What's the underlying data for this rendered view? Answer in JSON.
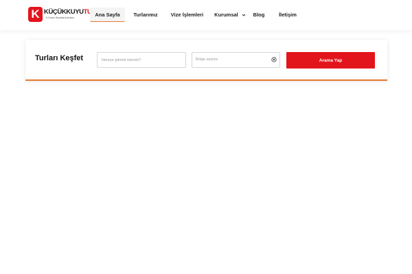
{
  "brand": {
    "logo_mark": "K",
    "name_main": "KÜÇÜKKUYU",
    "name_accent": "TUR",
    "tagline": "A Grubu Seyahat Acentası",
    "primary_color": "#e3151c",
    "accent_color": "#e8772e"
  },
  "nav": {
    "items": [
      {
        "label": "Ana Sayfa",
        "active": true
      },
      {
        "label": "Turlarımız"
      },
      {
        "label": "Vize İşlemleri"
      },
      {
        "label": "Kurumsal",
        "has_dropdown": true
      },
      {
        "label": "Blog"
      },
      {
        "label": "İletişim"
      }
    ]
  },
  "search": {
    "title": "Turları Keşfet",
    "destination_placeholder": "Nereye gitmek istersin?",
    "region_placeholder": "Bölge seçiniz",
    "button_label": "Arama Yap"
  }
}
